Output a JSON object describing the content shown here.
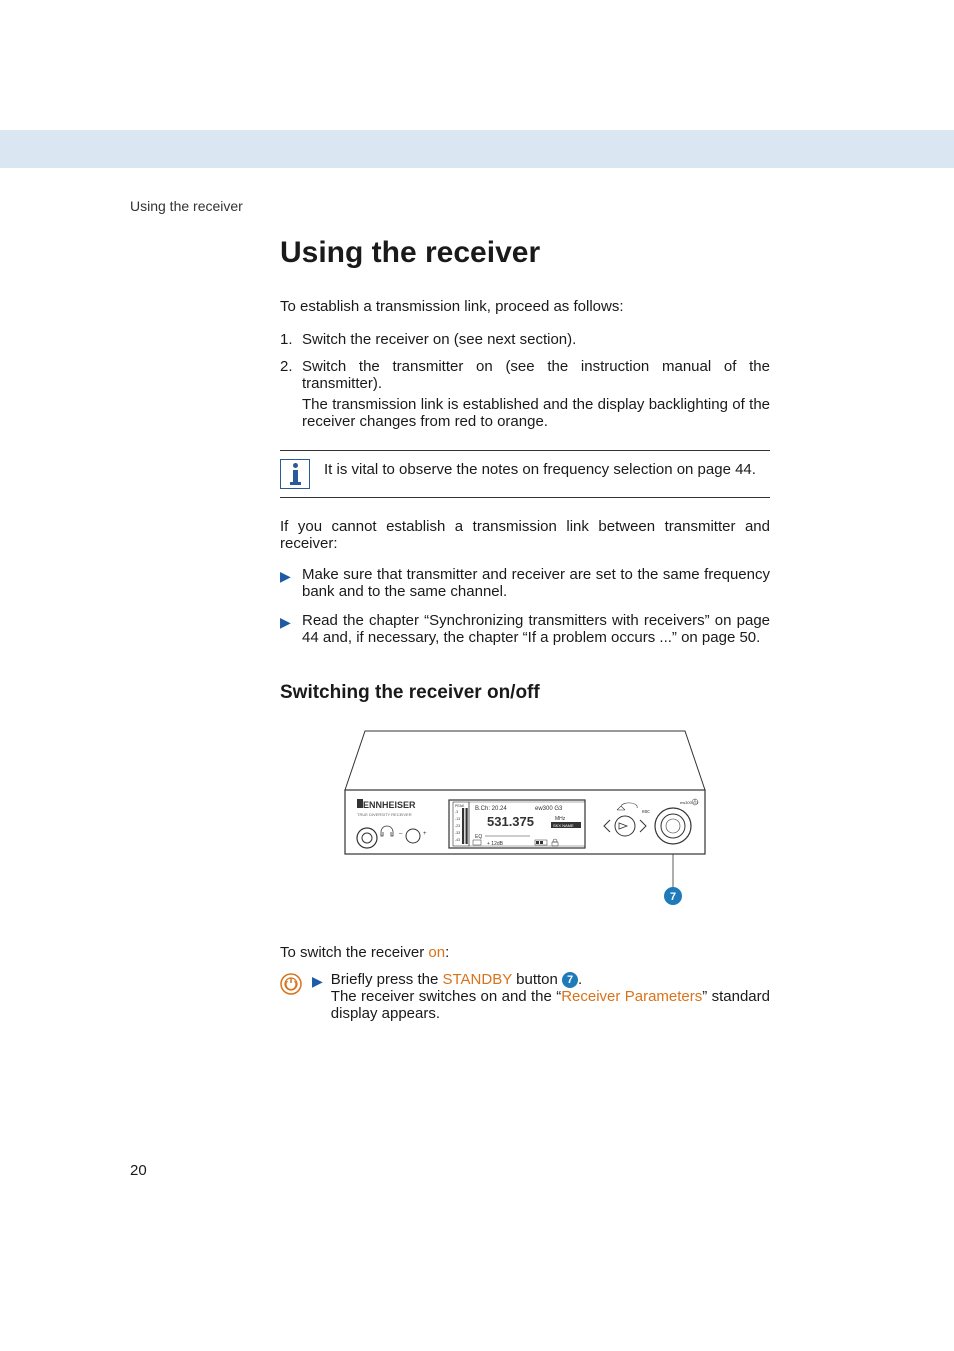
{
  "running_head": "Using the receiver",
  "title": "Using the receiver",
  "intro": "To establish a transmission link, proceed as follows:",
  "steps": [
    {
      "num": "1.",
      "text": "Switch the receiver on (see next section)."
    },
    {
      "num": "2.",
      "text": "Switch the transmitter on (see the instruction manual of the transmitter).",
      "sub": "The transmission link is established and the display backlighting of the receiver changes from red to orange."
    }
  ],
  "info_note": "It is vital to observe the notes on frequency selection on page 44.",
  "cannot_establish": "If you cannot establish a transmission link between transmitter and receiver:",
  "bullets": [
    "Make sure that transmitter and receiver are set to the same frequency bank and to the same channel.",
    "Read the chapter “Synchronizing transmitters with receivers” on page 44 and, if necessary, the chapter “If a problem occurs ...” on page 50."
  ],
  "subhead": "Switching the receiver on/off",
  "device": {
    "brand": "SENNHEISER",
    "tagline": "TRUE DIVERSITY RECEIVER",
    "bank_ch": "B.Ch: 20.24",
    "model": "ew300 G3",
    "freq": "531.375",
    "freq_unit": "MHz",
    "skx_name": "SKX NAME",
    "eq_label": "EQ",
    "gain": "+ 12dB",
    "callout": "7",
    "lcd_labels": [
      "PEAK",
      "-3",
      "-13",
      "-23",
      "-33",
      "-43"
    ]
  },
  "switch_on_prefix": "To switch the receiver ",
  "switch_on_word": "on",
  "switch_on_suffix": ":",
  "press_prefix": "Briefly press the ",
  "press_button": "STANDBY",
  "press_mid": " button ",
  "press_badge": "7",
  "press_end": ".",
  "result_prefix": "The receiver switches on and the “",
  "result_link": "Receiver Parameters",
  "result_suffix": "” standard display appears.",
  "page_number": "20"
}
